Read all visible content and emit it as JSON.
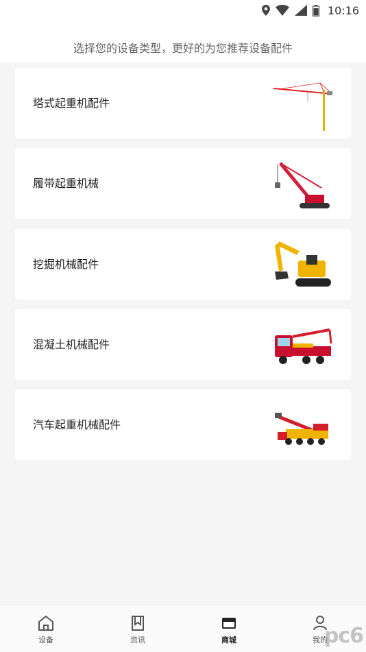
{
  "status_bar": {
    "time": "10:16"
  },
  "header": {
    "subtitle": "选择您的设备类型，更好的为您推荐设备配件"
  },
  "categories": [
    {
      "label": "塔式起重机配件",
      "icon": "tower-crane-image"
    },
    {
      "label": "履带起重机械",
      "icon": "crawler-crane-image"
    },
    {
      "label": "挖掘机械配件",
      "icon": "excavator-image"
    },
    {
      "label": "混凝土机械配件",
      "icon": "concrete-pump-truck-image"
    },
    {
      "label": "汽车起重机械配件",
      "icon": "truck-crane-image"
    }
  ],
  "tabs": [
    {
      "label": "设备",
      "icon": "home-icon"
    },
    {
      "label": "资讯",
      "icon": "bookmark-icon"
    },
    {
      "label": "商城",
      "icon": "store-icon",
      "active": true
    },
    {
      "label": "我的",
      "icon": "user-icon"
    }
  ],
  "watermark": "pc6"
}
